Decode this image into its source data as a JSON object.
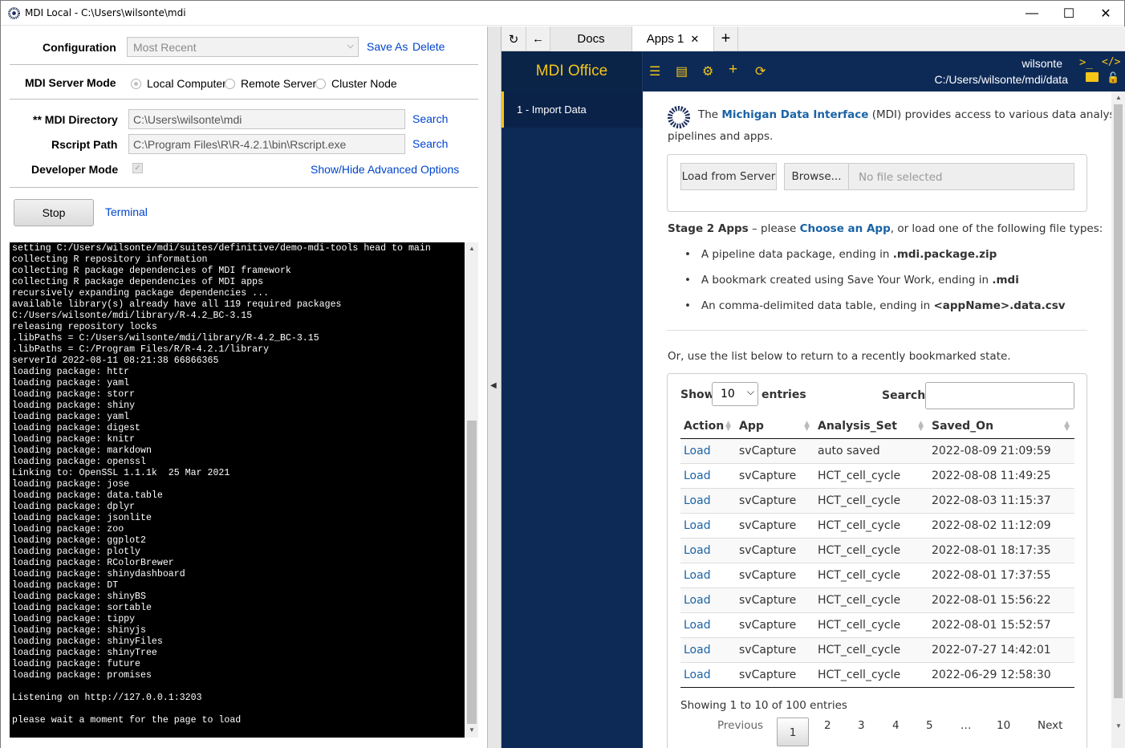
{
  "window": {
    "title": "MDI Local - C:\\Users\\wilsonte\\mdi",
    "minimize": "—",
    "maximize": "☐",
    "close": "✕"
  },
  "left": {
    "config_label": "Configuration",
    "config_value": "Most Recent",
    "save_as": "Save As",
    "delete": "Delete",
    "server_mode_label": "MDI Server Mode",
    "server_modes": [
      "Local Computer",
      "Remote Server",
      "Cluster Node"
    ],
    "mdi_dir_label": "** MDI Directory",
    "mdi_dir_value": "C:\\Users\\wilsonte\\mdi",
    "rscript_label": "Rscript Path",
    "rscript_value": "C:\\Program Files\\R\\R-4.2.1\\bin\\Rscript.exe",
    "search": "Search",
    "dev_mode_label": "Developer Mode",
    "show_hide": "Show/Hide Advanced Options",
    "stop": "Stop",
    "terminal": "Terminal",
    "console": "setting C:/Users/wilsonte/mdi/suites/definitive/demo-mdi-tools head to main\ncollecting R repository information\ncollecting R package dependencies of MDI framework\ncollecting R package dependencies of MDI apps\nrecursively expanding package dependencies ...\navailable library(s) already have all 119 required packages\nC:/Users/wilsonte/mdi/library/R-4.2_BC-3.15\nreleasing repository locks\n.libPaths = C:/Users/wilsonte/mdi/library/R-4.2_BC-3.15\n.libPaths = C:/Program Files/R/R-4.2.1/library\nserverId 2022-08-11 08:21:38 66866365\nloading package: httr\nloading package: yaml\nloading package: storr\nloading package: shiny\nloading package: yaml\nloading package: digest\nloading package: knitr\nloading package: markdown\nloading package: openssl\nLinking to: OpenSSL 1.1.1k  25 Mar 2021\nloading package: jose\nloading package: data.table\nloading package: dplyr\nloading package: jsonlite\nloading package: zoo\nloading package: ggplot2\nloading package: plotly\nloading package: RColorBrewer\nloading package: shinydashboard\nloading package: DT\nloading package: shinyBS\nloading package: sortable\nloading package: tippy\nloading package: shinyjs\nloading package: shinyFiles\nloading package: shinyTree\nloading package: future\nloading package: promises\n\nListening on http://127.0.0.1:3203\n\nplease wait a moment for the page to load"
  },
  "tabs": {
    "docs": "Docs",
    "apps": "Apps 1",
    "close": "✕",
    "add": "+"
  },
  "app": {
    "brand": "MDI Office",
    "user": "wilsonte",
    "path": "C:/Users/wilsonte/mdi/data",
    "sidebar_item": "1 - Import Data"
  },
  "content": {
    "intro_pre": "The ",
    "intro_link": "Michigan Data Interface",
    "intro_post": " (MDI) provides access to various data analysis",
    "intro_line2": "pipelines and apps.",
    "load_server": "Load from Server",
    "browse": "Browse...",
    "no_file": "No file selected",
    "stage2_bold": "Stage 2 Apps",
    "stage2_mid": " – please ",
    "stage2_link": "Choose an App",
    "stage2_post": ", or load one of the following file types:",
    "bullets": [
      {
        "pre": "A pipeline data package, ending in ",
        "b": ".mdi.package.zip"
      },
      {
        "pre": "A bookmark created using Save Your Work, ending in ",
        "b": ".mdi"
      },
      {
        "pre": "An comma-delimited data table, ending in ",
        "b": "<appName>.data.csv"
      }
    ],
    "or_text": "Or, use the list below to return to a recently bookmarked state.",
    "show": "Show",
    "entries_value": "10",
    "entries": "entries",
    "search_label": "Search:",
    "columns": [
      "Action",
      "App",
      "Analysis_Set",
      "Saved_On"
    ],
    "rows": [
      [
        "Load",
        "svCapture",
        "auto saved",
        "2022-08-09 21:09:59"
      ],
      [
        "Load",
        "svCapture",
        "HCT_cell_cycle",
        "2022-08-08 11:49:25"
      ],
      [
        "Load",
        "svCapture",
        "HCT_cell_cycle",
        "2022-08-03 11:15:37"
      ],
      [
        "Load",
        "svCapture",
        "HCT_cell_cycle",
        "2022-08-02 11:12:09"
      ],
      [
        "Load",
        "svCapture",
        "HCT_cell_cycle",
        "2022-08-01 18:17:35"
      ],
      [
        "Load",
        "svCapture",
        "HCT_cell_cycle",
        "2022-08-01 17:37:55"
      ],
      [
        "Load",
        "svCapture",
        "HCT_cell_cycle",
        "2022-08-01 15:56:22"
      ],
      [
        "Load",
        "svCapture",
        "HCT_cell_cycle",
        "2022-08-01 15:52:57"
      ],
      [
        "Load",
        "svCapture",
        "HCT_cell_cycle",
        "2022-07-27 14:42:01"
      ],
      [
        "Load",
        "svCapture",
        "HCT_cell_cycle",
        "2022-06-29 12:58:30"
      ]
    ],
    "showing": "Showing 1 to 10 of 100 entries",
    "pager": [
      "Previous",
      "1",
      "2",
      "3",
      "4",
      "5",
      "…",
      "10",
      "Next"
    ]
  }
}
